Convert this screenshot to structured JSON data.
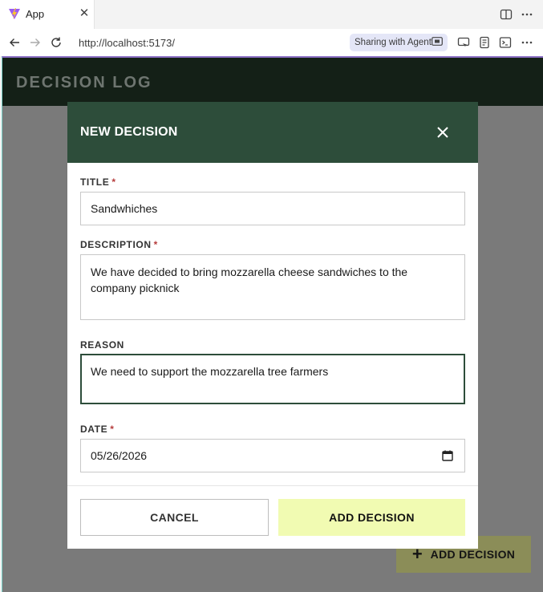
{
  "browser": {
    "tab_title": "App",
    "url": "http://localhost:5173/",
    "sharing_label": "Sharing with Agent"
  },
  "app": {
    "title": "DECISION LOG",
    "fab_label": "ADD DECISION"
  },
  "modal": {
    "title": "NEW DECISION",
    "fields": {
      "title": {
        "label": "TITLE",
        "required_mark": "*",
        "value": "Sandwhiches"
      },
      "description": {
        "label": "DESCRIPTION",
        "required_mark": "*",
        "value": "We have decided to bring mozzarella cheese sandwiches to the company picknick"
      },
      "reason": {
        "label": "REASON",
        "value": "We need to support the mozzarella tree farmers"
      },
      "date": {
        "label": "DATE",
        "required_mark": "*",
        "value": "05/26/2026"
      }
    },
    "cancel_label": "CANCEL",
    "submit_label": "ADD DECISION"
  },
  "colors": {
    "header_bg": "#142017",
    "modal_header_bg": "#2d4d3a",
    "accent_button": "#f1fbb2",
    "overlay": "#7a7a7a",
    "required": "#b63c3c"
  }
}
